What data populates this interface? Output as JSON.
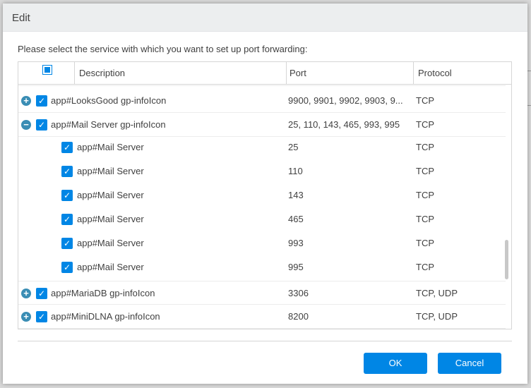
{
  "dialog": {
    "title": "Edit",
    "instruction": "Please select the service with which you want to set up port forwarding:",
    "ok_label": "OK",
    "cancel_label": "Cancel"
  },
  "table": {
    "columns": {
      "description": "Description",
      "port": "Port",
      "protocol": "Protocol"
    },
    "rows": [
      {
        "kind": "parent",
        "expander": "+",
        "description": "app#LooksGood gp-infoIcon",
        "port": "9900, 9901, 9902, 9903, 9...",
        "protocol": "TCP"
      },
      {
        "kind": "parent",
        "expander": "−",
        "description": "app#Mail Server gp-infoIcon",
        "port": "25, 110, 143, 465, 993, 995",
        "protocol": "TCP"
      },
      {
        "kind": "child",
        "description": "app#Mail Server",
        "port": "25",
        "protocol": "TCP"
      },
      {
        "kind": "child",
        "description": "app#Mail Server",
        "port": "110",
        "protocol": "TCP"
      },
      {
        "kind": "child",
        "description": "app#Mail Server",
        "port": "143",
        "protocol": "TCP"
      },
      {
        "kind": "child",
        "description": "app#Mail Server",
        "port": "465",
        "protocol": "TCP"
      },
      {
        "kind": "child",
        "description": "app#Mail Server",
        "port": "993",
        "protocol": "TCP"
      },
      {
        "kind": "child",
        "description": "app#Mail Server",
        "port": "995",
        "protocol": "TCP"
      },
      {
        "kind": "parent",
        "expander": "+",
        "description": "app#MariaDB gp-infoIcon",
        "port": "3306",
        "protocol": "TCP, UDP"
      },
      {
        "kind": "parent",
        "expander": "+",
        "description": "app#MiniDLNA gp-infoIcon",
        "port": "8200",
        "protocol": "TCP, UDP"
      }
    ]
  },
  "icons": {
    "expand": "plus-circle-icon",
    "collapse": "minus-circle-icon",
    "checkbox": "checkmark-icon"
  },
  "colors": {
    "accent": "#0086e5",
    "expander": "#3a8db4",
    "titlebar": "#eceeef"
  }
}
